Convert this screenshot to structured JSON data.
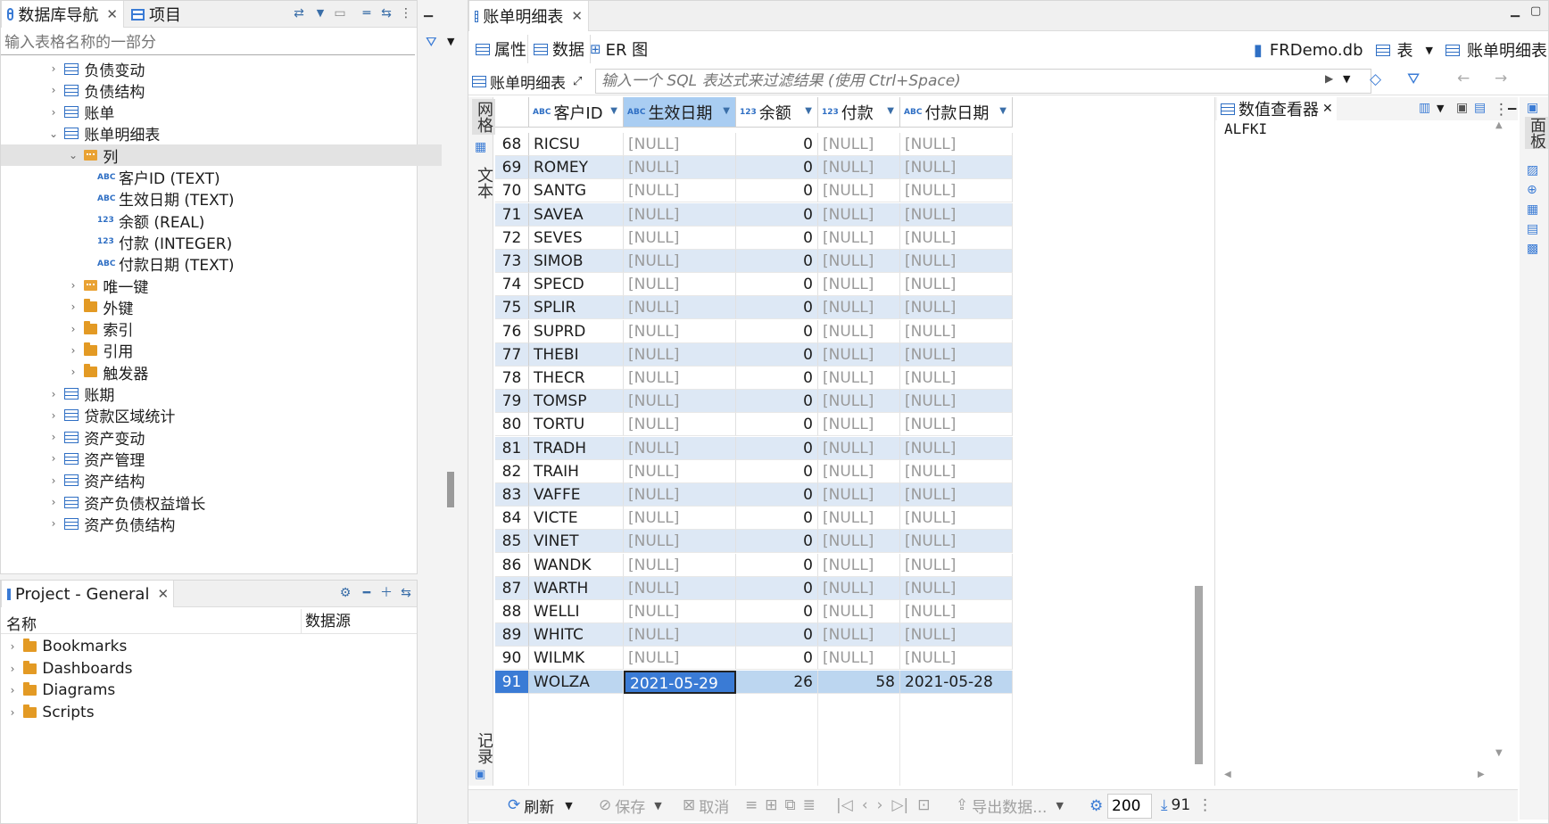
{
  "nav": {
    "tabs": [
      {
        "label": "数据库导航",
        "icon": "database-navigator-icon"
      },
      {
        "label": "项目",
        "icon": "project-icon"
      }
    ],
    "filter_placeholder": "输入表格名称的一部分",
    "tree": [
      {
        "label": "负债变动",
        "level": 1,
        "icon": "table-icon",
        "expanded": false
      },
      {
        "label": "负债结构",
        "level": 1,
        "icon": "table-icon",
        "expanded": false
      },
      {
        "label": "账单",
        "level": 1,
        "icon": "table-icon",
        "expanded": false
      },
      {
        "label": "账单明细表",
        "level": 1,
        "icon": "table-icon",
        "expanded": true
      },
      {
        "label": "列",
        "level": 2,
        "icon": "columns-folder-icon",
        "expanded": true,
        "selected": true
      },
      {
        "label": "客户ID (TEXT)",
        "level": 3,
        "icon": "text-column-icon",
        "type_tag": "ABC"
      },
      {
        "label": "生效日期 (TEXT)",
        "level": 3,
        "icon": "text-column-icon",
        "type_tag": "ABC"
      },
      {
        "label": "余额 (REAL)",
        "level": 3,
        "icon": "number-column-icon",
        "type_tag": "123"
      },
      {
        "label": "付款 (INTEGER)",
        "level": 3,
        "icon": "number-column-icon",
        "type_tag": "123"
      },
      {
        "label": "付款日期 (TEXT)",
        "level": 3,
        "icon": "text-column-icon",
        "type_tag": "ABC"
      },
      {
        "label": "唯一键",
        "level": 2,
        "icon": "unique-key-folder-icon",
        "expanded": false
      },
      {
        "label": "外键",
        "level": 2,
        "icon": "folder-icon",
        "expanded": false
      },
      {
        "label": "索引",
        "level": 2,
        "icon": "folder-icon",
        "expanded": false
      },
      {
        "label": "引用",
        "level": 2,
        "icon": "folder-icon",
        "expanded": false
      },
      {
        "label": "触发器",
        "level": 2,
        "icon": "folder-icon",
        "expanded": false
      },
      {
        "label": "账期",
        "level": 1,
        "icon": "table-icon",
        "expanded": false
      },
      {
        "label": "贷款区域统计",
        "level": 1,
        "icon": "table-icon",
        "expanded": false
      },
      {
        "label": "资产变动",
        "level": 1,
        "icon": "table-icon",
        "expanded": false
      },
      {
        "label": "资产管理",
        "level": 1,
        "icon": "table-icon",
        "expanded": false
      },
      {
        "label": "资产结构",
        "level": 1,
        "icon": "table-icon",
        "expanded": false
      },
      {
        "label": "资产负债权益增长",
        "level": 1,
        "icon": "table-icon",
        "expanded": false
      },
      {
        "label": "资产负债结构",
        "level": 1,
        "icon": "table-icon",
        "expanded": false
      }
    ]
  },
  "project": {
    "tab_label": "Project - General",
    "columns": [
      "名称",
      "数据源"
    ],
    "items": [
      {
        "label": "Bookmarks",
        "icon": "bookmarks-folder-icon"
      },
      {
        "label": "Dashboards",
        "icon": "dashboards-folder-icon"
      },
      {
        "label": "Diagrams",
        "icon": "diagrams-folder-icon"
      },
      {
        "label": "Scripts",
        "icon": "scripts-folder-icon"
      }
    ]
  },
  "editor": {
    "tab_label": "账单明细表",
    "subtabs": [
      "属性",
      "数据",
      "ER 图"
    ],
    "active_subtab": "数据",
    "breadcrumb": {
      "db": "FRDemo.db",
      "type": "表",
      "table": "账单明细表"
    },
    "filter_table_label": "账单明细表",
    "filter_placeholder": "输入一个 SQL 表达式来过滤结果 (使用 Ctrl+Space)",
    "side_tabs": {
      "grid": "网格",
      "text": "文本",
      "record": "记录"
    }
  },
  "grid": {
    "columns": [
      {
        "name": "客户ID",
        "type_tag": "ABC",
        "align": "left"
      },
      {
        "name": "生效日期",
        "type_tag": "ABC",
        "align": "left",
        "sorted": true
      },
      {
        "name": "余额",
        "type_tag": "123",
        "align": "right"
      },
      {
        "name": "付款",
        "type_tag": "123",
        "align": "right"
      },
      {
        "name": "付款日期",
        "type_tag": "ABC",
        "align": "left"
      }
    ],
    "rows": [
      {
        "n": "68",
        "c": [
          "RICSU",
          "[NULL]",
          "0",
          "[NULL]",
          "[NULL]"
        ]
      },
      {
        "n": "69",
        "c": [
          "ROMEY",
          "[NULL]",
          "0",
          "[NULL]",
          "[NULL]"
        ]
      },
      {
        "n": "70",
        "c": [
          "SANTG",
          "[NULL]",
          "0",
          "[NULL]",
          "[NULL]"
        ]
      },
      {
        "n": "71",
        "c": [
          "SAVEA",
          "[NULL]",
          "0",
          "[NULL]",
          "[NULL]"
        ]
      },
      {
        "n": "72",
        "c": [
          "SEVES",
          "[NULL]",
          "0",
          "[NULL]",
          "[NULL]"
        ]
      },
      {
        "n": "73",
        "c": [
          "SIMOB",
          "[NULL]",
          "0",
          "[NULL]",
          "[NULL]"
        ]
      },
      {
        "n": "74",
        "c": [
          "SPECD",
          "[NULL]",
          "0",
          "[NULL]",
          "[NULL]"
        ]
      },
      {
        "n": "75",
        "c": [
          "SPLIR",
          "[NULL]",
          "0",
          "[NULL]",
          "[NULL]"
        ]
      },
      {
        "n": "76",
        "c": [
          "SUPRD",
          "[NULL]",
          "0",
          "[NULL]",
          "[NULL]"
        ]
      },
      {
        "n": "77",
        "c": [
          "THEBI",
          "[NULL]",
          "0",
          "[NULL]",
          "[NULL]"
        ]
      },
      {
        "n": "78",
        "c": [
          "THECR",
          "[NULL]",
          "0",
          "[NULL]",
          "[NULL]"
        ]
      },
      {
        "n": "79",
        "c": [
          "TOMSP",
          "[NULL]",
          "0",
          "[NULL]",
          "[NULL]"
        ]
      },
      {
        "n": "80",
        "c": [
          "TORTU",
          "[NULL]",
          "0",
          "[NULL]",
          "[NULL]"
        ]
      },
      {
        "n": "81",
        "c": [
          "TRADH",
          "[NULL]",
          "0",
          "[NULL]",
          "[NULL]"
        ]
      },
      {
        "n": "82",
        "c": [
          "TRAIH",
          "[NULL]",
          "0",
          "[NULL]",
          "[NULL]"
        ]
      },
      {
        "n": "83",
        "c": [
          "VAFFE",
          "[NULL]",
          "0",
          "[NULL]",
          "[NULL]"
        ]
      },
      {
        "n": "84",
        "c": [
          "VICTE",
          "[NULL]",
          "0",
          "[NULL]",
          "[NULL]"
        ]
      },
      {
        "n": "85",
        "c": [
          "VINET",
          "[NULL]",
          "0",
          "[NULL]",
          "[NULL]"
        ]
      },
      {
        "n": "86",
        "c": [
          "WANDK",
          "[NULL]",
          "0",
          "[NULL]",
          "[NULL]"
        ]
      },
      {
        "n": "87",
        "c": [
          "WARTH",
          "[NULL]",
          "0",
          "[NULL]",
          "[NULL]"
        ]
      },
      {
        "n": "88",
        "c": [
          "WELLI",
          "[NULL]",
          "0",
          "[NULL]",
          "[NULL]"
        ]
      },
      {
        "n": "89",
        "c": [
          "WHITC",
          "[NULL]",
          "0",
          "[NULL]",
          "[NULL]"
        ]
      },
      {
        "n": "90",
        "c": [
          "WILMK",
          "[NULL]",
          "0",
          "[NULL]",
          "[NULL]"
        ]
      },
      {
        "n": "91",
        "c": [
          "WOLZA",
          "2021-05-29",
          "26",
          "58",
          "2021-05-28"
        ],
        "selected": true
      }
    ]
  },
  "viewer": {
    "tab_label": "数值查看器",
    "value": "ALFKI",
    "side_tab": "面板"
  },
  "bottombar": {
    "refresh": "刷新",
    "save": "保存",
    "cancel": "取消",
    "export": "导出数据...",
    "fetch_size": "200",
    "row_count": "91"
  },
  "colors": {
    "accent": "#3a7bd5",
    "sorted_header": "#a9cdf2",
    "alt_row": "#dde8f5",
    "selected_row": "#bcd6f0",
    "null_text": "#9a9a9a"
  }
}
